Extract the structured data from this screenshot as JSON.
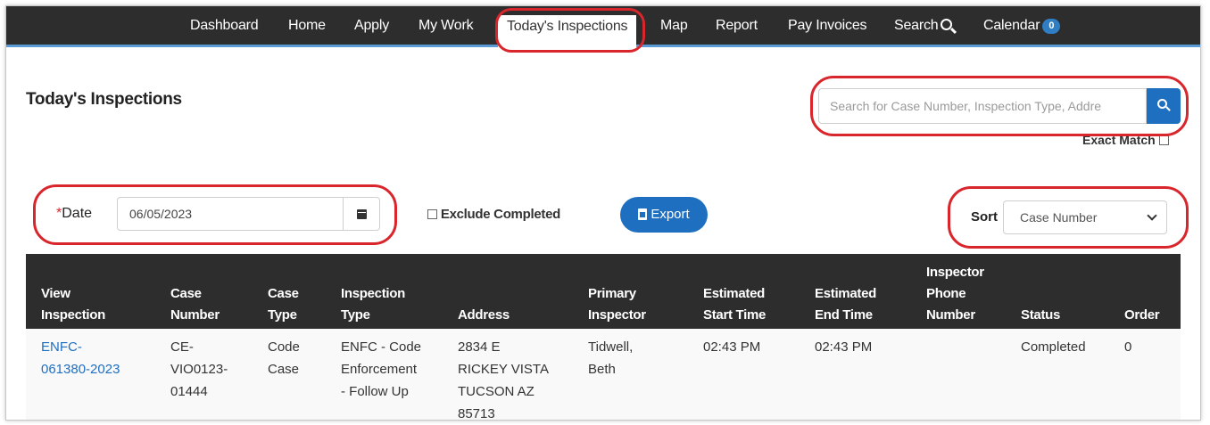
{
  "nav": {
    "items": [
      "Dashboard",
      "Home",
      "Apply",
      "My Work",
      "Today's Inspections",
      "Map",
      "Report",
      "Pay Invoices",
      "Search",
      "Calendar"
    ],
    "active": "Today's Inspections",
    "calendar_badge": "0",
    "search_icon": "search-icon"
  },
  "page": {
    "title": "Today's Inspections"
  },
  "search": {
    "placeholder": "Search for Case Number, Inspection Type, Addre",
    "button_icon": "search-icon",
    "exact_match_label": "Exact Match"
  },
  "filters": {
    "date_required_mark": "*",
    "date_label": "Date",
    "date_value": "06/05/2023",
    "calendar_icon": "calendar-icon",
    "exclude_completed_label": "Exclude Completed",
    "export_label": "Export",
    "sort_label": "Sort",
    "sort_value": "Case Number"
  },
  "table": {
    "headers": [
      [
        "View",
        "Inspection"
      ],
      [
        "Case",
        "Number"
      ],
      [
        "Case",
        "Type"
      ],
      [
        "Inspection",
        "Type"
      ],
      [
        "Address"
      ],
      [
        "Primary",
        "Inspector"
      ],
      [
        "Estimated",
        "Start Time"
      ],
      [
        "Estimated",
        "End Time"
      ],
      [
        "Inspector",
        "Phone",
        "Number"
      ],
      [
        "Status"
      ],
      [
        "Order"
      ]
    ],
    "rows": [
      {
        "view_inspection": [
          "ENFC-",
          "061380-2023"
        ],
        "case_number": [
          "CE-",
          "VIO0123-",
          "01444"
        ],
        "case_type": [
          "Code",
          "Case"
        ],
        "inspection_type": [
          "ENFC - Code",
          "Enforcement",
          "- Follow Up"
        ],
        "address": [
          "2834 E",
          "RICKEY VISTA",
          "TUCSON AZ",
          "85713"
        ],
        "primary_inspector": [
          "Tidwell,",
          "Beth"
        ],
        "start_time": "02:43 PM",
        "end_time": "02:43 PM",
        "phone": "",
        "status": "Completed",
        "order": "0"
      }
    ]
  },
  "colors": {
    "nav_bg": "#2d2d2d",
    "accent_blue": "#1f6fc1",
    "highlight_red": "#d9262c",
    "table_header_bg": "#2d2d2d"
  }
}
